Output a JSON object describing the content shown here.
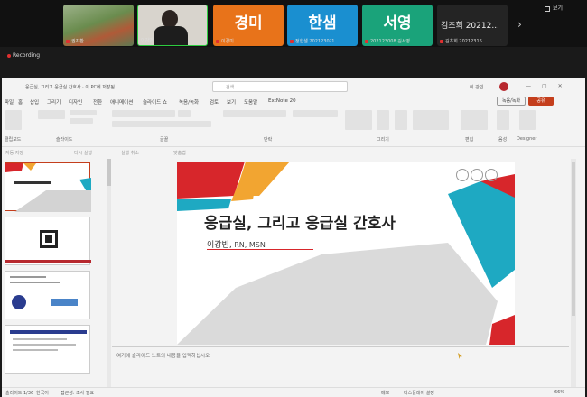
{
  "zoom": {
    "participants": [
      {
        "kind": "video",
        "name": "권지환"
      },
      {
        "kind": "video",
        "name": "이강빈",
        "active": true
      },
      {
        "kind": "avatar",
        "initials": "경미",
        "name": "이경미",
        "color": "#e8731a"
      },
      {
        "kind": "avatar",
        "initials": "한샘",
        "name": "정한샘 2021230?1",
        "color": "#1a8fd0"
      },
      {
        "kind": "avatar",
        "initials": "서영",
        "name": "202123008 김서영",
        "color": "#1aa37a"
      },
      {
        "kind": "text",
        "label": "김초희 20212...",
        "name": "김초희 20212316"
      }
    ],
    "view_label": "보기",
    "recording_label": "Recording",
    "next_arrow": "›"
  },
  "ppt": {
    "title_bar": "응급실, 그리고 응급실 간호사 · 이 PC에 저장됨",
    "search_placeholder": "검색",
    "user": "이 강빈",
    "menu": [
      "파일",
      "홈",
      "삽입",
      "그리기",
      "디자인",
      "전환",
      "애니메이션",
      "슬라이드 쇼",
      "녹음/녹화",
      "검토",
      "보기",
      "도움말",
      "ExtNote 20"
    ],
    "record_btn": "녹음/녹화",
    "share_btn": "공유",
    "ribbon_groups": [
      "클립보드",
      "슬라이드",
      "글꼴",
      "단락",
      "그리기",
      "편집",
      "음성",
      "Designer"
    ],
    "qa": [
      "자동 저장",
      "다시 실행",
      "실행 취소",
      "맞춤법"
    ],
    "slide": {
      "title": "응급실, 그리고 응급실 간호사",
      "author": "이강빈,",
      "credentials": " RN, MSN"
    },
    "notes_placeholder": "여기에 슬라이드 노트의 내용을 입력하십시오",
    "status": {
      "slide": "슬라이드 1/36",
      "lang": "한국어",
      "access": "접근성: 조사 필요",
      "notes": "메모",
      "display": "디스플레이 설정",
      "zoom": "66%"
    },
    "colors": {
      "red": "#d7262b",
      "orange": "#f2a531",
      "teal": "#1ea9c2",
      "gray": "#d3d3d3"
    }
  }
}
